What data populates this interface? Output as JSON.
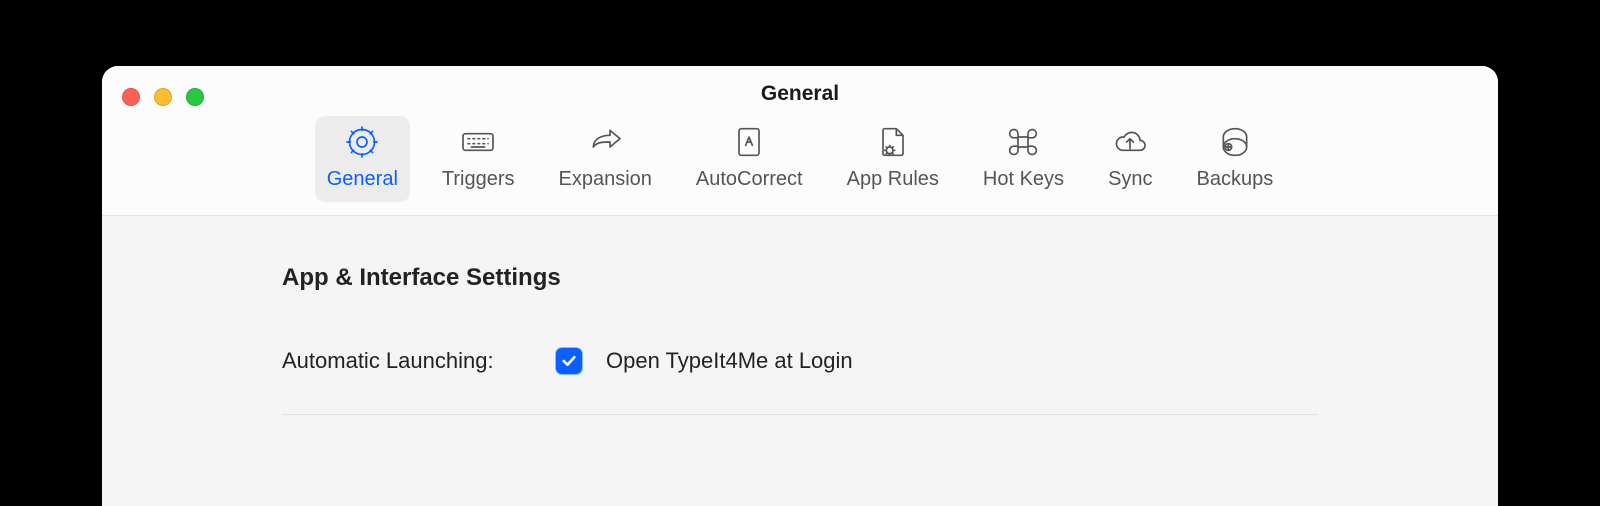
{
  "window": {
    "title": "General"
  },
  "toolbar": {
    "items": [
      {
        "label": "General"
      },
      {
        "label": "Triggers"
      },
      {
        "label": "Expansion"
      },
      {
        "label": "AutoCorrect"
      },
      {
        "label": "App Rules"
      },
      {
        "label": "Hot Keys"
      },
      {
        "label": "Sync"
      },
      {
        "label": "Backups"
      }
    ]
  },
  "content": {
    "section_title": "App & Interface Settings",
    "automatic_launching_label": "Automatic Launching:",
    "open_at_login_label": "Open TypeIt4Me at Login",
    "open_at_login_checked": true
  }
}
